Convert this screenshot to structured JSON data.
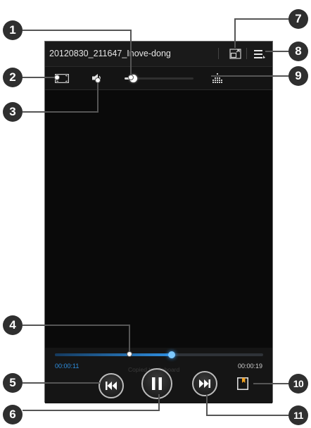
{
  "player": {
    "title": "20120830_211647_Inove-dong",
    "volume_level": 0.12,
    "progress": 0.56,
    "elapsed_time": "00:00:11",
    "total_time": "00:00:19",
    "watermark": "Copied to clipboard",
    "accent_color": "#2f8fe0",
    "icons": {
      "screen_mode": "screen-mode-icon",
      "volume": "speaker-icon",
      "popup_play": "popup-play-icon",
      "list": "list-icon",
      "sound_effects": "equalizer-icon",
      "previous": "rewind-icon",
      "pause": "pause-icon",
      "next": "fast-forward-icon",
      "bookmark": "bookmark-icon"
    }
  },
  "callouts": [
    "1",
    "2",
    "3",
    "4",
    "5",
    "6",
    "7",
    "8",
    "9",
    "10",
    "11"
  ]
}
